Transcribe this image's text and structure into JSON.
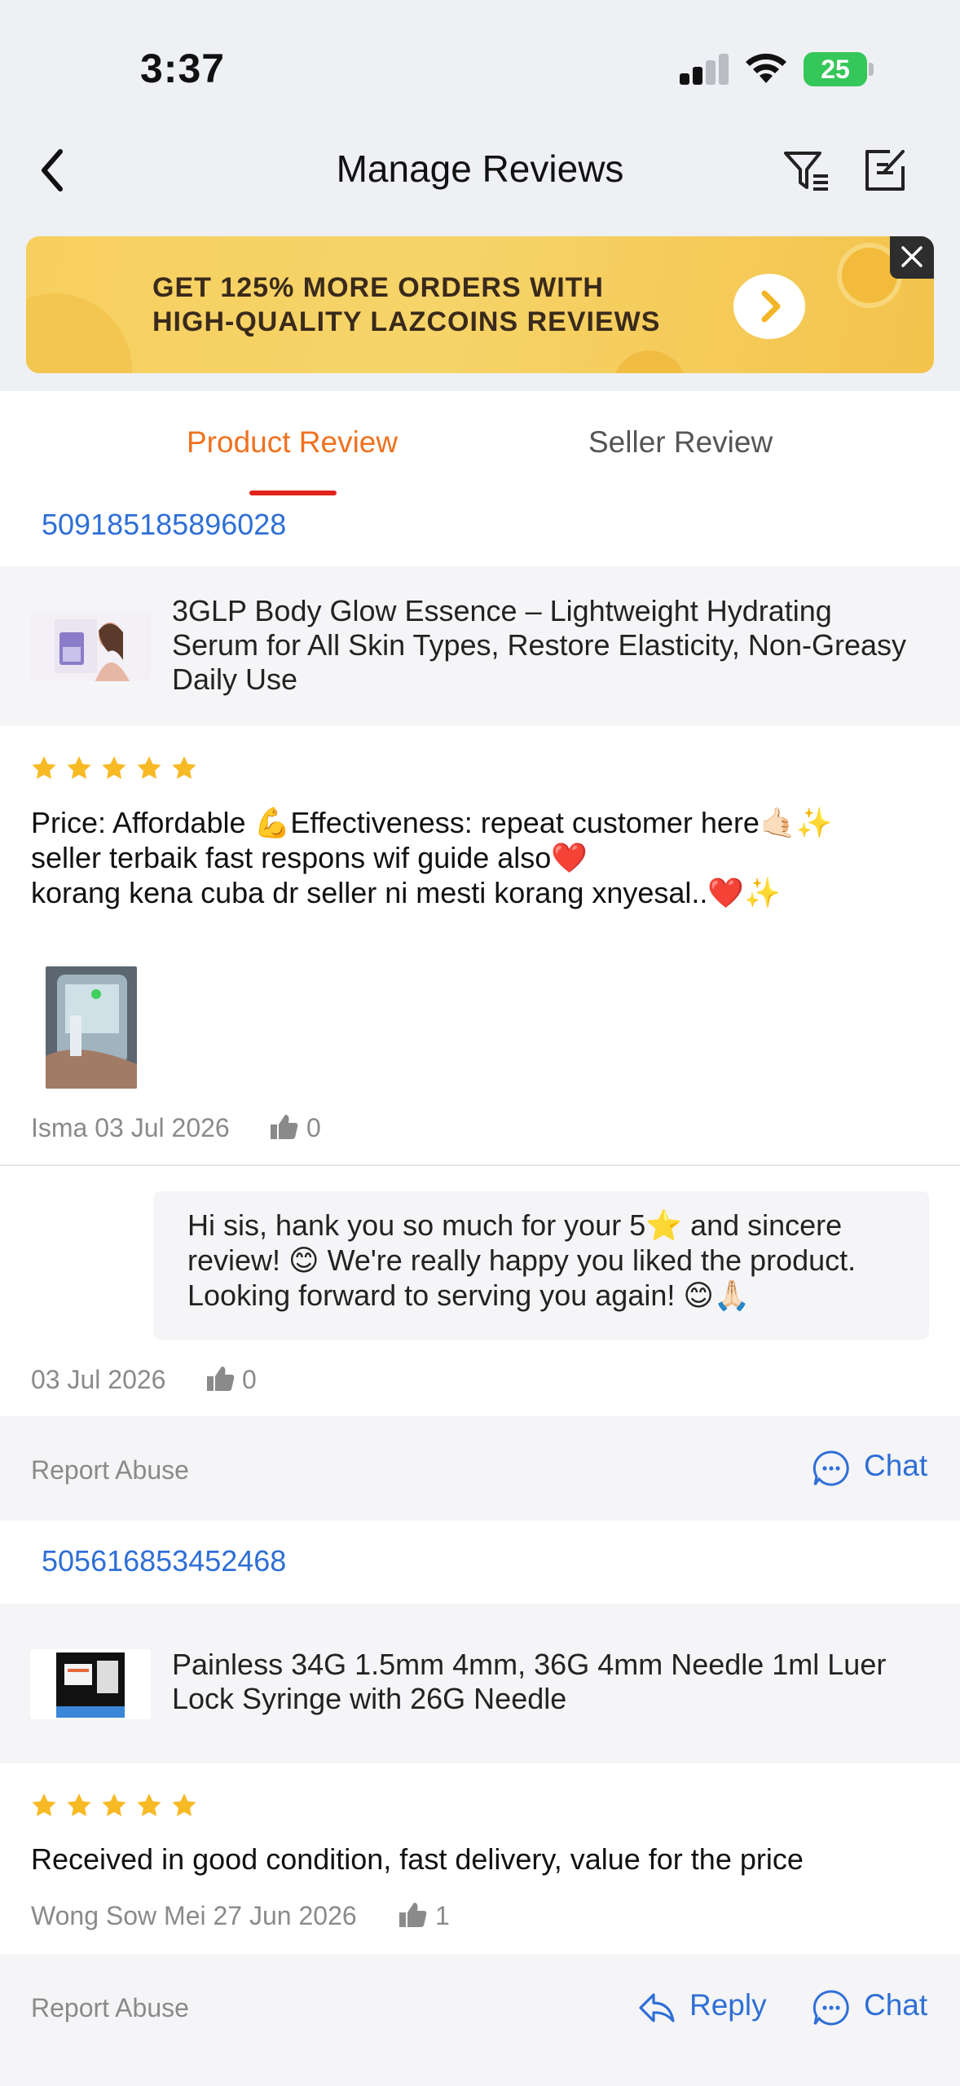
{
  "status_bar": {
    "time": "3:37",
    "battery": "25"
  },
  "header": {
    "title": "Manage Reviews"
  },
  "banner": {
    "line1": "GET 125% MORE ORDERS WITH",
    "line2": "HIGH-QUALITY LAZCOINS REVIEWS"
  },
  "tabs": {
    "product": "Product Review",
    "seller": "Seller Review",
    "active": "Product Review"
  },
  "reviews": [
    {
      "order_id": "509185185896028",
      "product_name": "3GLP Body Glow Essence – Lightweight Hydrating Serum for All Skin Types, Restore Elasticity, Non-Greasy Daily Use",
      "rating": 5,
      "line1": "Price:  Affordable 💪Effectiveness:  repeat customer here🤙🏻✨",
      "line2": "seller terbaik fast respons wif guide also❤️",
      "line3": "korang kena cuba dr seller ni mesti korang xnyesal..❤️✨",
      "author_date": "Isma 03 Jul 2026",
      "likes": "0",
      "reply": {
        "text": "Hi sis, hank you so much for your 5⭐ and sincere review! 😊 We're really happy you liked the product. Looking forward to serving you again! 😊🙏🏻",
        "date": "03 Jul 2026",
        "likes": "0"
      },
      "report_label": "Report Abuse",
      "chat_label": "Chat"
    },
    {
      "order_id": "505616853452468",
      "product_name": "Painless 34G 1.5mm 4mm, 36G 4mm Needle 1ml Luer Lock Syringe with 26G Needle",
      "rating": 5,
      "text": "Received in good condition, fast delivery, value for the price",
      "author_date": "Wong Sow Mei 27 Jun 2026",
      "likes": "1",
      "report_label": "Report Abuse",
      "reply_label": "Reply",
      "chat_label": "Chat"
    }
  ],
  "colors": {
    "accent_orange": "#f0711f",
    "tab_underline": "#e3231d",
    "link_blue": "#2f6fd6",
    "star": "#f7b924"
  }
}
